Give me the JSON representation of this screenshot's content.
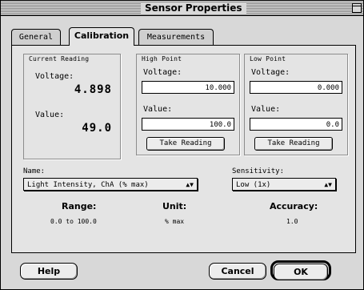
{
  "window": {
    "title": "Sensor Properties"
  },
  "tabs": [
    {
      "label": "General",
      "active": false
    },
    {
      "label": "Calibration",
      "active": true
    },
    {
      "label": "Measurements",
      "active": false
    }
  ],
  "current_reading": {
    "group_label": "Current Reading",
    "voltage_label": "Voltage:",
    "voltage_value": "4.898",
    "value_label": "Value:",
    "value_value": "49.0"
  },
  "high_point": {
    "group_label": "High Point",
    "voltage_label": "Voltage:",
    "voltage_input": "10.000",
    "value_label": "Value:",
    "value_input": "100.0",
    "take_reading_label": "Take Reading"
  },
  "low_point": {
    "group_label": "Low Point",
    "voltage_label": "Voltage:",
    "voltage_input": "0.000",
    "value_label": "Value:",
    "value_input": "0.0",
    "take_reading_label": "Take Reading"
  },
  "name": {
    "label": "Name:",
    "selected": "Light Intensity, ChA (% max)"
  },
  "sensitivity": {
    "label": "Sensitivity:",
    "selected": "Low (1x)"
  },
  "stats": {
    "range_label": "Range:",
    "range_value": "0.0 to 100.0",
    "unit_label": "Unit:",
    "unit_value": "% max",
    "accuracy_label": "Accuracy:",
    "accuracy_value": "1.0"
  },
  "buttons": {
    "help": "Help",
    "cancel": "Cancel",
    "ok": "OK"
  },
  "icons": {
    "popup_arrow": "updown-arrow-icon",
    "zoom_box": "zoom-box-icon"
  }
}
